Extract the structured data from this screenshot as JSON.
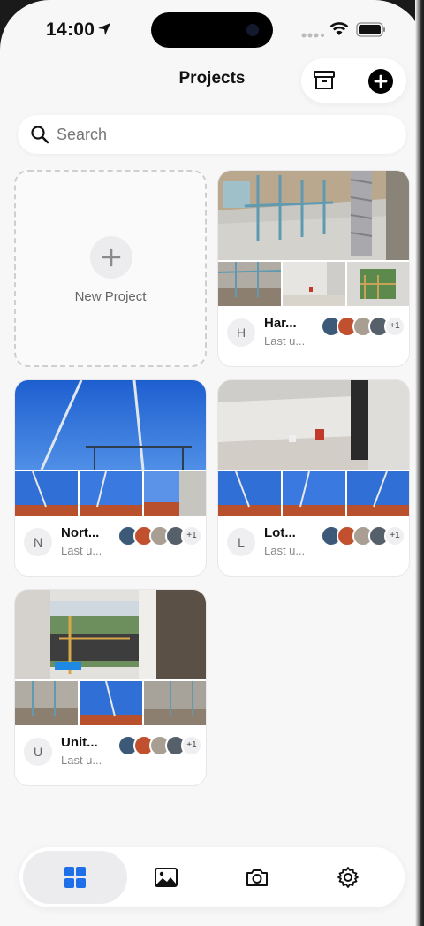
{
  "status_bar": {
    "time": "14:00"
  },
  "header": {
    "title": "Projects",
    "archive_icon": "archive-box-icon",
    "add_icon": "plus-circle-icon"
  },
  "search": {
    "placeholder": "Search",
    "value": ""
  },
  "new_project": {
    "label": "New Project"
  },
  "projects": [
    {
      "initial": "H",
      "name": "Har...",
      "subtitle": "Last u...",
      "extra_members": "+1"
    },
    {
      "initial": "N",
      "name": "Nort...",
      "subtitle": "Last u...",
      "extra_members": "+1"
    },
    {
      "initial": "L",
      "name": "Lot...",
      "subtitle": "Last u...",
      "extra_members": "+1"
    },
    {
      "initial": "U",
      "name": "Unit...",
      "subtitle": "Last u...",
      "extra_members": "+1"
    }
  ],
  "tab_bar": {
    "tabs": [
      {
        "icon": "grid-icon",
        "active": true
      },
      {
        "icon": "photo-icon",
        "active": false
      },
      {
        "icon": "camera-icon",
        "active": false
      },
      {
        "icon": "gear-icon",
        "active": false
      }
    ]
  },
  "colors": {
    "accent": "#1f6fe8",
    "background": "#f7f7f8",
    "text": "#111111",
    "muted": "#888888"
  }
}
